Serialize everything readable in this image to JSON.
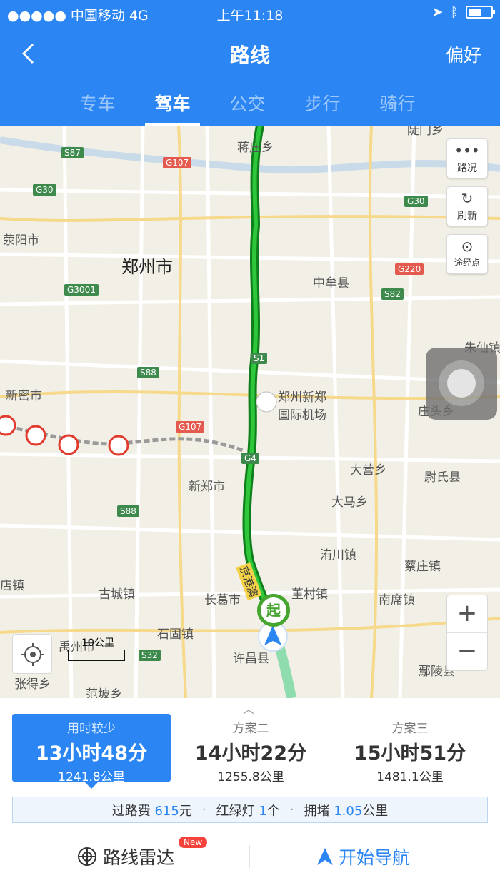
{
  "status": {
    "carrier": "●●●●● 中国移动  4G",
    "time": "上午11:18"
  },
  "nav": {
    "title": "路线",
    "preference": "偏好"
  },
  "tabs": [
    {
      "label": "专车"
    },
    {
      "label": "驾车"
    },
    {
      "label": "公交"
    },
    {
      "label": "步行"
    },
    {
      "label": "骑行"
    }
  ],
  "map": {
    "controls": {
      "traffic": "路况",
      "refresh": "刷新",
      "waypoint": "途经点"
    },
    "scale": "10公里",
    "start_marker": "起",
    "labels": {
      "zhengzhou": "郑州市",
      "jiangzhuang": "蒋庄乡",
      "xingyang": "荥阳市",
      "zhongmou": "中牟县",
      "xinmi": "新密市",
      "airport1": "郑州新郑",
      "airport2": "国际机场",
      "xinzheng": "新郑市",
      "zhuangtou": "庄头乡",
      "daying": "大营乡",
      "weishi": "尉氏县",
      "dama": "大马乡",
      "weichuan": "洧川镇",
      "caizhuang": "蔡庄镇",
      "nanxi": "南席镇",
      "dongcun": "董村镇",
      "changge": "长葛市",
      "gucheng": "古城镇",
      "shigu": "石固镇",
      "yuzhou": "禹州市",
      "xuchang": "许昌县",
      "yanling": "鄢陵县",
      "zhangde": "张得乡",
      "fanpo": "范坡乡",
      "dian": "店镇",
      "zhuxian": "朱仙镇",
      "jinggang": "京港澳",
      "suiting": "陡门乡"
    },
    "shields": {
      "s87": "S87",
      "g107a": "G107",
      "g30a": "G30",
      "g30b": "G30",
      "g3001": "G3001",
      "g220": "G220",
      "s82": "S82",
      "s1": "S1",
      "s88a": "S88",
      "g107b": "G107",
      "g4": "G4",
      "s88b": "S88",
      "s32": "S32"
    }
  },
  "plans": [
    {
      "label": "用时较少",
      "time": "13小时48分",
      "distance": "1241.8公里"
    },
    {
      "label": "方案二",
      "time": "14小时22分",
      "distance": "1255.8公里"
    },
    {
      "label": "方案三",
      "time": "15小时51分",
      "distance": "1481.1公里"
    }
  ],
  "stats": {
    "toll_label": "过路费",
    "toll_value": "615",
    "toll_unit": "元",
    "lights_label": "红绿灯",
    "lights_value": "1",
    "lights_unit": "个",
    "jam_label": "拥堵",
    "jam_value": "1.05",
    "jam_unit": "公里"
  },
  "actions": {
    "radar": "路线雷达",
    "radar_badge": "New",
    "navigate": "开始导航"
  },
  "colors": {
    "primary": "#2b86f4",
    "route": "#1fae2c",
    "start": "#45a52e"
  }
}
